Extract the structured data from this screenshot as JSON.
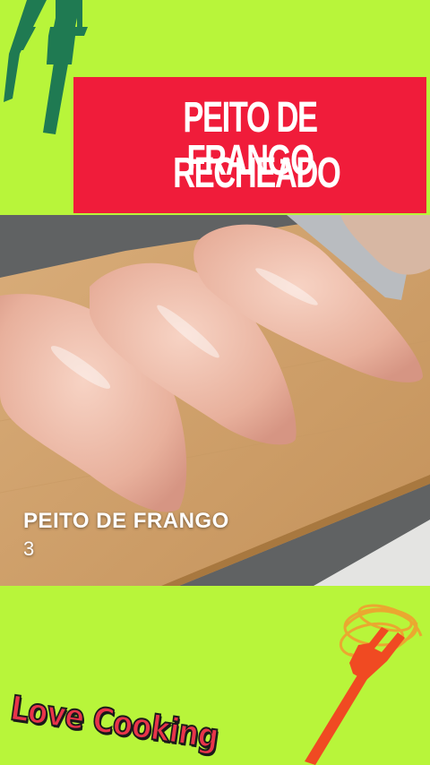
{
  "title": {
    "line1": "PEITO DE FRANGO",
    "line2": "RECHEADO"
  },
  "video": {
    "ingredient_label": "PEITO DE FRANGO",
    "ingredient_count": "3"
  },
  "logo": {
    "text": "Love Cooking"
  },
  "colors": {
    "background": "#b8f53a",
    "banner": "#f01c3a",
    "fork_top": "#1f7a52",
    "fork_bottom": "#f04a22",
    "logo_text": "#e8344a"
  },
  "icons": [
    "fork-icon",
    "fork-pasta-icon"
  ]
}
